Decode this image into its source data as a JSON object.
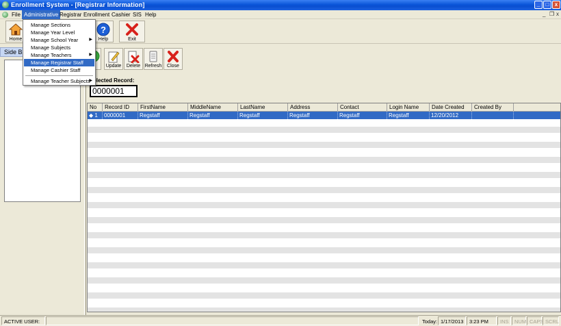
{
  "window": {
    "title": "Enrollment System - [Registrar Information]",
    "min_glyph": "_",
    "max_glyph": "□",
    "close_glyph": "x",
    "mdi_min": "_",
    "mdi_restore": "❐",
    "mdi_close": "x"
  },
  "menubar": {
    "items": [
      "File",
      "Administrative",
      "Registrar",
      "Enrollment",
      "Cashier",
      "SIS",
      "Help"
    ],
    "active": "Administrative"
  },
  "toolbar": {
    "home_label": "Home",
    "help_label": "Help",
    "exit_label": "Exit"
  },
  "dropdown": {
    "items": [
      {
        "label": "Manage Sections",
        "submenu": false
      },
      {
        "label": "Manage Year Level",
        "submenu": false
      },
      {
        "label": "Manage School Year",
        "submenu": true
      },
      {
        "label": "Manage Subjects",
        "submenu": false
      },
      {
        "label": "Manage Teachers",
        "submenu": true
      },
      {
        "label": "Manage Registrar Staff",
        "submenu": false,
        "highlighted": true
      },
      {
        "label": "Manage Cashier Staff",
        "submenu": false
      },
      {
        "label": "Manage Teacher Subjects",
        "submenu": true
      }
    ]
  },
  "sidebar": {
    "title": "Side Bar"
  },
  "toolbar2": {
    "new_label": "New",
    "update_label": "Update",
    "delete_label": "Delete",
    "refresh_label": "Refresh",
    "close_label": "Close"
  },
  "selected_record": {
    "label": "Selected Record:",
    "value": "0000001"
  },
  "grid": {
    "columns": [
      "No",
      "Record ID",
      "FirstName",
      "MiddleName",
      "LastName",
      "Address",
      "Contact",
      "Login Name",
      "Date Created",
      "Created By"
    ],
    "rows": [
      [
        "1",
        "0000001",
        "Regstaff",
        "Regstaff",
        "Regstaff",
        "Regstaff",
        "Regstaff",
        "Regstaff",
        "12/20/2012",
        ""
      ]
    ]
  },
  "statusbar": {
    "active_user_label": "ACTIVE USER:",
    "active_user": "",
    "today_label": "Today:",
    "date": "1/17/2013",
    "time": "3:23 PM",
    "ins": "INS",
    "num": "NUM",
    "caps": "CAPS",
    "scrl": "SCRL"
  },
  "colors": {
    "titlebar": "#0a55d8",
    "highlight": "#316ac5",
    "exit_red": "#d8221b",
    "help_blue": "#1d5fd6"
  }
}
